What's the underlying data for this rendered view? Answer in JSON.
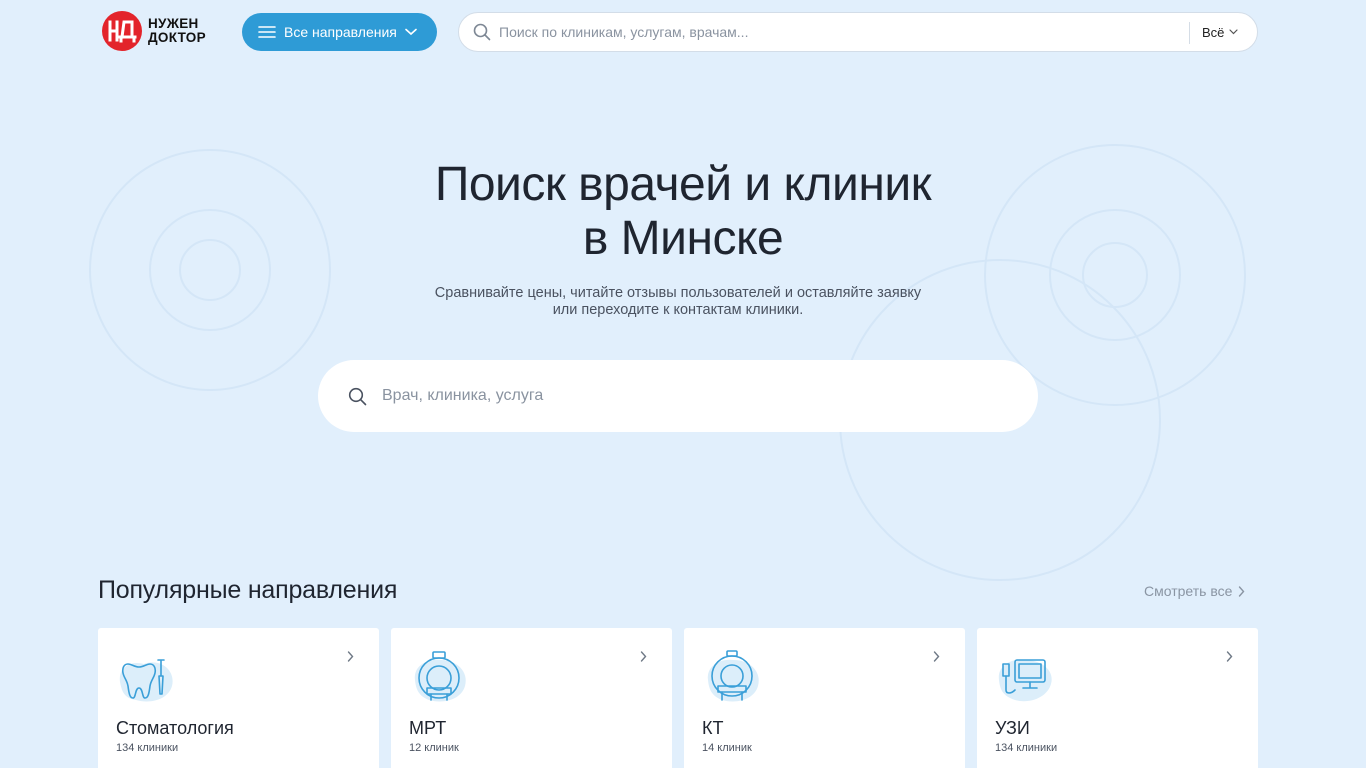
{
  "header": {
    "logo": {
      "line1": "НУЖЕН",
      "line2": "ДОКТОР"
    },
    "directions_button": "Все направления",
    "search": {
      "placeholder": "Поиск по клиникам, услугам, врачам...",
      "scope": "Всё"
    }
  },
  "hero": {
    "title_line1": "Поиск врачей и клиник",
    "title_line2": "в Минске",
    "subtitle_line1": "Сравнивайте цены, читайте отзывы пользователей и оставляйте заявку",
    "subtitle_line2": "или переходите к контактам клиники.",
    "search_placeholder": "Врач, клиника, услуга"
  },
  "popular": {
    "title": "Популярные направления",
    "see_all": "Смотреть все",
    "items": [
      {
        "name": "Стоматология",
        "count": "134 клиники",
        "icon": "tooth-icon"
      },
      {
        "name": "МРТ",
        "count": "12 клиник",
        "icon": "mri-scanner-icon"
      },
      {
        "name": "КТ",
        "count": "14 клиник",
        "icon": "ct-scanner-icon"
      },
      {
        "name": "УЗИ",
        "count": "134 клиники",
        "icon": "ultrasound-icon"
      }
    ]
  },
  "colors": {
    "background": "#e1effc",
    "accent": "#2e9bd6",
    "logo_red": "#e3242b",
    "icon_blue": "#3a9fd8"
  }
}
